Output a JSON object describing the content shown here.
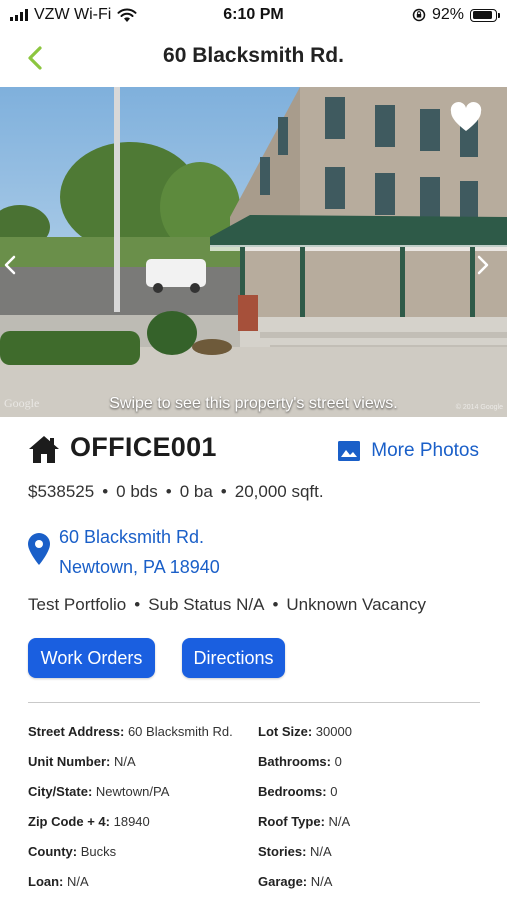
{
  "status_bar": {
    "carrier": "VZW Wi-Fi",
    "time": "6:10 PM",
    "battery": "92%"
  },
  "nav": {
    "title": "60 Blacksmith Rd."
  },
  "photo": {
    "caption": "Swipe to see this property's street views.",
    "watermark": "Google",
    "copyright": "© 2014 Google"
  },
  "property": {
    "code": "OFFICE001",
    "more_photos_label": "More Photos",
    "price": "$538525",
    "beds": "0 bds",
    "baths": "0 ba",
    "sqft": "20,000 sqft.",
    "address_line1": "60 Blacksmith Rd.",
    "address_line2": "Newtown, PA 18940",
    "portfolio": "Test Portfolio",
    "sub_status": "Sub Status N/A",
    "vacancy": "Unknown Vacancy"
  },
  "actions": {
    "work_orders": "Work Orders",
    "directions": "Directions"
  },
  "details_left": [
    {
      "label": "Street Address:",
      "value": "60 Blacksmith Rd."
    },
    {
      "label": "Unit Number:",
      "value": "N/A"
    },
    {
      "label": "City/State:",
      "value": "Newtown/PA"
    },
    {
      "label": "Zip Code + 4:",
      "value": "18940"
    },
    {
      "label": "County:",
      "value": "Bucks"
    },
    {
      "label": "Loan:",
      "value": "N/A"
    }
  ],
  "details_right": [
    {
      "label": "Lot Size:",
      "value": "30000"
    },
    {
      "label": "Bathrooms:",
      "value": "0"
    },
    {
      "label": "Bedrooms:",
      "value": "0"
    },
    {
      "label": "Roof Type:",
      "value": "N/A"
    },
    {
      "label": "Stories:",
      "value": "N/A"
    },
    {
      "label": "Garage:",
      "value": "N/A"
    }
  ],
  "colors": {
    "accent": "#1a5fe0",
    "link": "#1a5fc8",
    "back_chevron": "#8cc63f"
  },
  "icons": {
    "back": "chevron-left-icon",
    "favorite": "heart-icon",
    "home": "home-icon",
    "photos": "image-icon",
    "location": "map-pin-icon"
  }
}
